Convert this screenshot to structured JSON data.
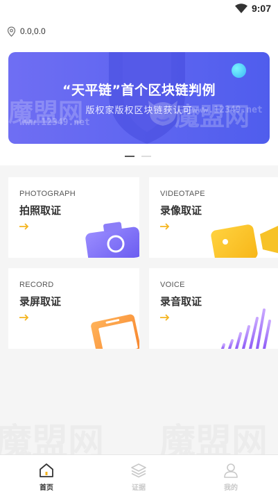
{
  "status_bar": {
    "time": "9:07",
    "icons": [
      "wifi-icon"
    ]
  },
  "location": {
    "icon": "location-pin-icon",
    "coordinates": "0.0,0.0"
  },
  "banner": {
    "title": "“天平链”首个区块链判例",
    "subtitle": "版权家版权区块链获认可",
    "watermark_main": "魔盟网",
    "watermark_url": "www.12349.net",
    "accent_color": "#5f66f0"
  },
  "pager": {
    "count": 2,
    "active_index": 0
  },
  "cards": [
    {
      "en": "PHOTOGRAPH",
      "cn": "拍照取证",
      "icon": "camera-icon"
    },
    {
      "en": "VIDEOTAPE",
      "cn": "录像取证",
      "icon": "video-camera-icon"
    },
    {
      "en": "RECORD",
      "cn": "录屏取证",
      "icon": "phone-screen-icon"
    },
    {
      "en": "VOICE",
      "cn": "录音取证",
      "icon": "sound-wave-icon"
    }
  ],
  "arrow_color": "#f5b51f",
  "tabs": [
    {
      "label": "首页",
      "icon": "home-icon",
      "active": true
    },
    {
      "label": "证据",
      "icon": "layers-icon",
      "active": false
    },
    {
      "label": "我的",
      "icon": "user-icon",
      "active": false
    }
  ]
}
